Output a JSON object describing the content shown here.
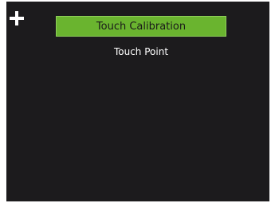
{
  "header": {
    "title": "Touch Calibration",
    "subtitle": "Touch Point"
  },
  "target": {
    "icon": "crosshair-plus-icon",
    "color": "#ffffff"
  },
  "colors": {
    "screen_background": "#1c1b1d",
    "title_bar": "#6ab42f",
    "title_text": "#1a1a1a",
    "subtitle_text": "#ffffff"
  }
}
